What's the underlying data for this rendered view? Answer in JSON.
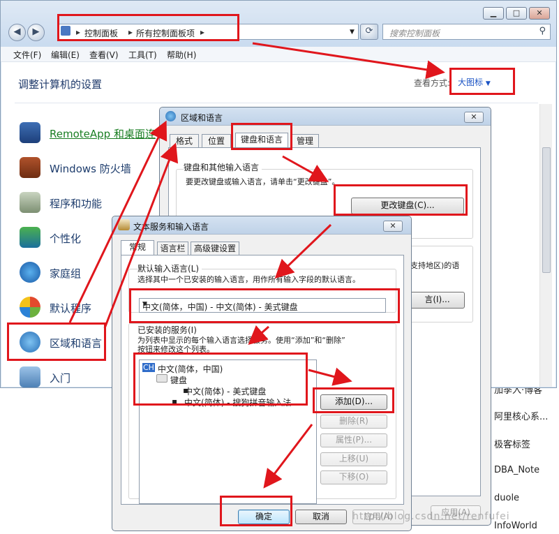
{
  "control_panel": {
    "breadcrumb": [
      "控制面板",
      "所有控制面板项"
    ],
    "search_placeholder": "搜索控制面板",
    "menu": [
      "文件(F)",
      "编辑(E)",
      "查看(V)",
      "工具(T)",
      "帮助(H)"
    ],
    "heading": "调整计算机的设置",
    "view_by_label": "查看方式:",
    "view_by_value": "大图标",
    "items": [
      "RemoteApp 和桌面连",
      "Windows 防火墙",
      "程序和功能",
      "个性化",
      "家庭组",
      "默认程序",
      "区域和语言",
      "入门"
    ]
  },
  "region_dialog": {
    "title": "区域和语言",
    "tabs": [
      "格式",
      "位置",
      "键盘和语言",
      "管理"
    ],
    "group_title": "键盘和其他输入语言",
    "instruction": "要更改键盘或输入语言，请单击“更改键盘”。",
    "change_keyboard_button": "更改键盘(C)...",
    "partial_text": "支持地区)的语",
    "partial_button": "言(I)...",
    "apply_button": "应用(A)"
  },
  "text_services_dialog": {
    "title": "文本服务和输入语言",
    "tabs": [
      "常规",
      "语言栏",
      "高级键设置"
    ],
    "default_lang_title": "默认输入语言(L)",
    "default_lang_desc": "选择其中一个已安装的输入语言，用作所有输入字段的默认语言。",
    "default_lang_value": "中文(简体，中国) - 中文(简体) - 美式键盘",
    "installed_title": "已安装的服务(I)",
    "installed_desc_1": "为列表中显示的每个输入语言选择服务。使用“添加”和“删除”",
    "installed_desc_2": "按钮来修改这个列表。",
    "tree": {
      "lang_code": "CH",
      "language": "中文(简体，中国)",
      "category": "键盘",
      "services": [
        "中文(简体) - 美式键盘",
        "中文(简体) - 搜狗拼音输入法"
      ]
    },
    "buttons": {
      "add": "添加(D)...",
      "remove": "删除(R)",
      "properties": "属性(P)...",
      "move_up": "上移(U)",
      "move_down": "下移(O)",
      "ok": "确定",
      "cancel": "取消",
      "apply": "应用(A)"
    }
  },
  "background_list": [
    "加季入·博客",
    "阿里核心系...",
    "极客标签",
    "DBA_Note",
    "duole",
    "InfoWorld"
  ],
  "watermark": "http://blog.csdn.net/renfufei",
  "annotation_color": "#e0161c"
}
